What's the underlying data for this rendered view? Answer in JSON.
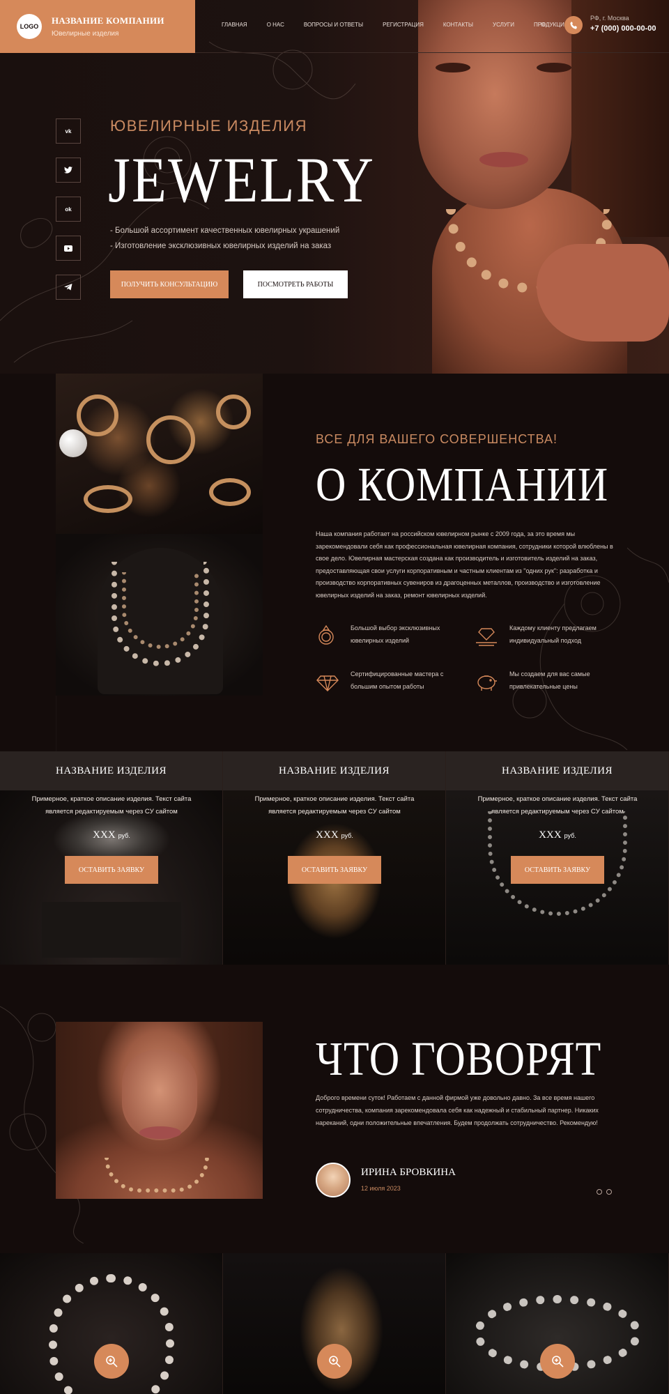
{
  "header": {
    "logo": "LOGO",
    "company_name": "НАЗВАНИЕ КОМПАНИИ",
    "company_sub": "Ювелирные изделия",
    "nav": [
      "ГЛАВНАЯ",
      "О НАС",
      "ВОПРОСЫ И ОТВЕТЫ",
      "РЕГИСТРАЦИЯ",
      "КОНТАКТЫ",
      "УСЛУГИ",
      "ПРОДУКЦИЯ"
    ],
    "city": "РФ, г. Москва",
    "phone": "+7 (000) 000-00-00",
    "menu_icon": "burger-icon",
    "phone_icon": "phone-icon"
  },
  "hero": {
    "kicker": "ЮВЕЛИРНЫЕ ИЗДЕЛИЯ",
    "title": "JEWELRY",
    "bullet1": "- Большой ассортимент качественных ювелирных украшений",
    "bullet2": "- Изготовление эксклюзивных ювелирных изделий на заказ",
    "btn_primary": "ПОЛУЧИТЬ КОНСУЛЬТАЦИЮ",
    "btn_secondary": "ПОСМОТРЕТЬ РАБОТЫ",
    "socials": [
      "vk-icon",
      "twitter-icon",
      "odnoklassniki-icon",
      "youtube-icon",
      "telegram-icon"
    ]
  },
  "about": {
    "kicker": "ВСЕ ДЛЯ ВАШЕГО СОВЕРШЕНСТВА!",
    "title": "О КОМПАНИИ",
    "text": "Наша компания работает на российском ювелирном рынке с 2009 года, за это время мы зарекомендовали себя как профессиональная ювелирная компания, сотрудники которой влюблены в свое дело. Ювелирная мастерская создана как производитель и изготовитель изделий на заказ, предоставляющая свои услуги корпоративным и частным клиентам из \"одних рук\": разработка и производство корпоративных сувениров из драгоценных металлов, производство и изготовление ювелирных изделий на заказ, ремонт ювелирных изделий.",
    "features": [
      {
        "text": "Большой выбор эксклюзивных ювелирных изделий",
        "icon": "ring-icon"
      },
      {
        "text": "Каждому клиенту предлагаем индивидуальный подход",
        "icon": "diamond-hand-icon"
      },
      {
        "text": "Сертифицированные мастера с большим опытом работы",
        "icon": "diamond-icon"
      },
      {
        "text": "Мы создаем для вас самые привлекательные цены",
        "icon": "piggy-bank-icon"
      }
    ]
  },
  "products": [
    {
      "title": "НАЗВАНИЕ ИЗДЕЛИЯ",
      "desc": "Примерное, краткое описание изделия. Текст сайта является редактируемым через CУ сайтом",
      "price": "XXX",
      "currency": "руб.",
      "button": "ОСТАВИТЬ ЗАЯВКУ"
    },
    {
      "title": "НАЗВАНИЕ ИЗДЕЛИЯ",
      "desc": "Примерное, краткое описание изделия. Текст сайта является редактируемым через CУ сайтом",
      "price": "XXX",
      "currency": "руб.",
      "button": "ОСТАВИТЬ ЗАЯВКУ"
    },
    {
      "title": "НАЗВАНИЕ ИЗДЕЛИЯ",
      "desc": "Примерное, краткое описание изделия. Текст сайта является редактируемым через CУ сайтом",
      "price": "XXX",
      "currency": "руб.",
      "button": "ОСТАВИТЬ ЗАЯВКУ"
    }
  ],
  "testimonial": {
    "title": "ЧТО ГОВОРЯТ",
    "text": "Доброго времени суток! Работаем с данной фирмой уже довольно давно. За все время нашего сотрудничества, компания зарекомендовала себя как надежный и стабильный партнер. Никаких нареканий, одни положительные впечатления. Будем продолжать сотрудничество. Рекомендую!",
    "author": "ИРИНА БРОВКИНА",
    "date": "12 июля 2023"
  },
  "gallery": {
    "zoom_icon": "zoom-icon"
  },
  "colors": {
    "accent": "#d6895a",
    "background": "#140c0b",
    "header_bar": "#2a2321"
  }
}
